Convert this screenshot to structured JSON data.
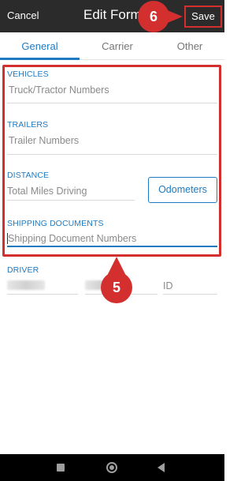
{
  "header": {
    "cancel_label": "Cancel",
    "title": "Edit Form",
    "save_label": "Save"
  },
  "tabs": [
    {
      "label": "General",
      "active": true
    },
    {
      "label": "Carrier",
      "active": false
    },
    {
      "label": "Other",
      "active": false
    }
  ],
  "form": {
    "vehicles": {
      "label": "VEHICLES",
      "placeholder": "Truck/Tractor Numbers"
    },
    "trailers": {
      "label": "TRAILERS",
      "placeholder": "Trailer Numbers"
    },
    "distance": {
      "label": "DISTANCE",
      "placeholder": "Total Miles Driving",
      "button_label": "Odometers"
    },
    "shipping": {
      "label": "SHIPPING DOCUMENTS",
      "placeholder": "Shipping Document Numbers"
    },
    "driver": {
      "label": "DRIVER",
      "id_placeholder": "ID"
    }
  },
  "callouts": {
    "save_step": "6",
    "form_step": "5"
  },
  "colors": {
    "accent": "#1e7ac3",
    "header_bg": "#2b2b2b",
    "callout": "#d32f2f"
  },
  "navbar": {
    "icons": [
      "recents-square-icon",
      "home-circle-icon",
      "back-triangle-icon"
    ]
  }
}
